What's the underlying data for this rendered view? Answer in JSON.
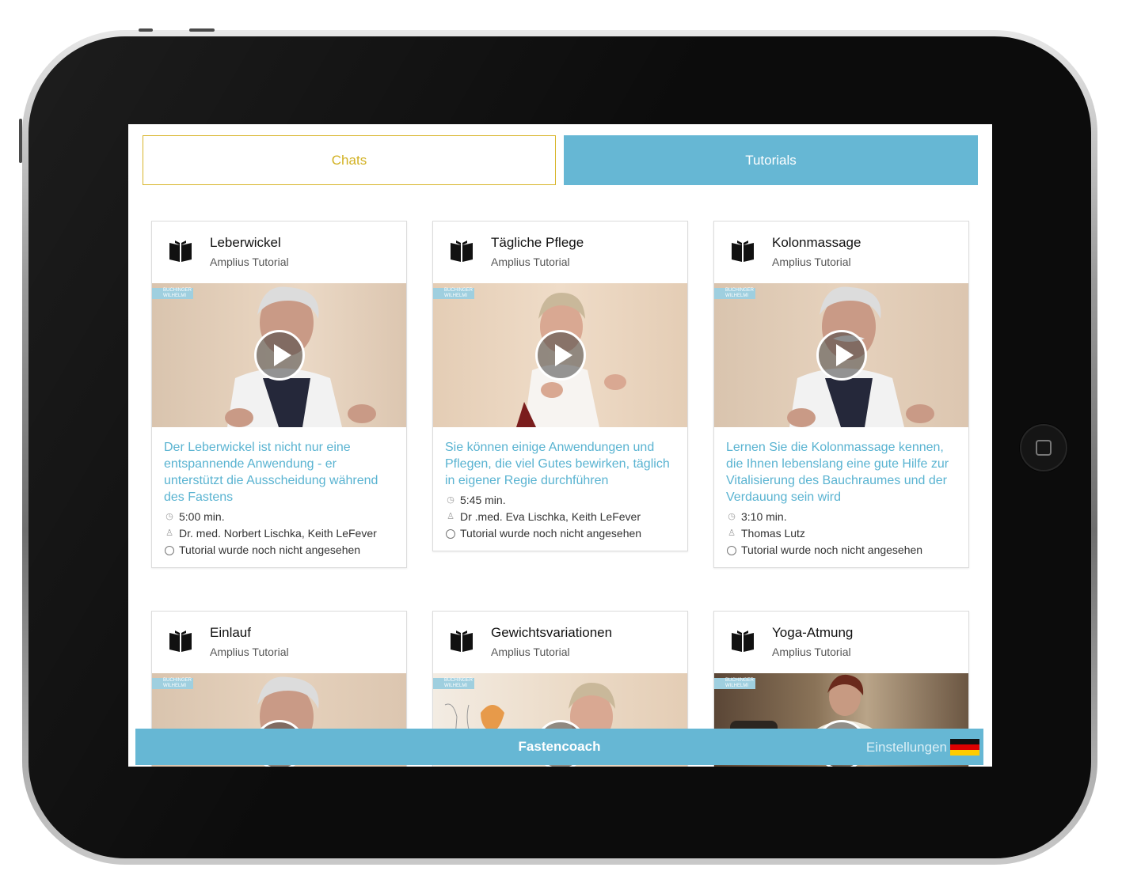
{
  "tabs": {
    "chats_label": "Chats",
    "tutorials_label": "Tutorials",
    "active": "Tutorials"
  },
  "cards": [
    {
      "title": "Leberwickel",
      "subtitle": "Amplius Tutorial",
      "description": "Der Leberwickel ist nicht nur eine entspannende Anwendung - er unterstützt die Ausscheidung während des Fastens",
      "duration": "5:00 min.",
      "authors": "Dr. med. Norbert Lischka, Keith LeFever",
      "status": "Tutorial wurde noch nicht angesehen",
      "brand": "BUCHINGER WILHELMI"
    },
    {
      "title": "Tägliche Pflege",
      "subtitle": "Amplius Tutorial",
      "description": "Sie können einige Anwendungen und Pflegen, die viel Gutes bewirken, täglich in eigener Regie durchführen",
      "duration": "5:45 min.",
      "authors": "Dr .med. Eva Lischka, Keith LeFever",
      "status": "Tutorial wurde noch nicht angesehen",
      "brand": "BUCHINGER WILHELMI"
    },
    {
      "title": "Kolonmassage",
      "subtitle": "Amplius Tutorial",
      "description": "Lernen Sie die Kolonmassage kennen, die Ihnen lebenslang eine gute Hilfe zur Vitalisierung des Bauchraumes und der Verdauung sein wird",
      "duration": "3:10 min.",
      "authors": "Thomas Lutz",
      "status": "Tutorial wurde noch nicht angesehen",
      "brand": "BUCHINGER WILHELMI"
    },
    {
      "title": "Einlauf",
      "subtitle": "Amplius Tutorial",
      "brand": "BUCHINGER WILHELMI"
    },
    {
      "title": "Gewichtsvariationen",
      "subtitle": "Amplius Tutorial",
      "brand": "BUCHINGER WILHELMI"
    },
    {
      "title": "Yoga-Atmung",
      "subtitle": "Amplius Tutorial",
      "brand": "BUCHINGER WILHELMI"
    }
  ],
  "bottom_bar": {
    "title": "Fastencoach",
    "settings_label": "Einstellungen",
    "language_flag": "german-flag-icon"
  },
  "colors": {
    "accent_blue": "#66b7d4",
    "link_blue": "#59b3d1",
    "chats_gold": "#d2b122"
  }
}
